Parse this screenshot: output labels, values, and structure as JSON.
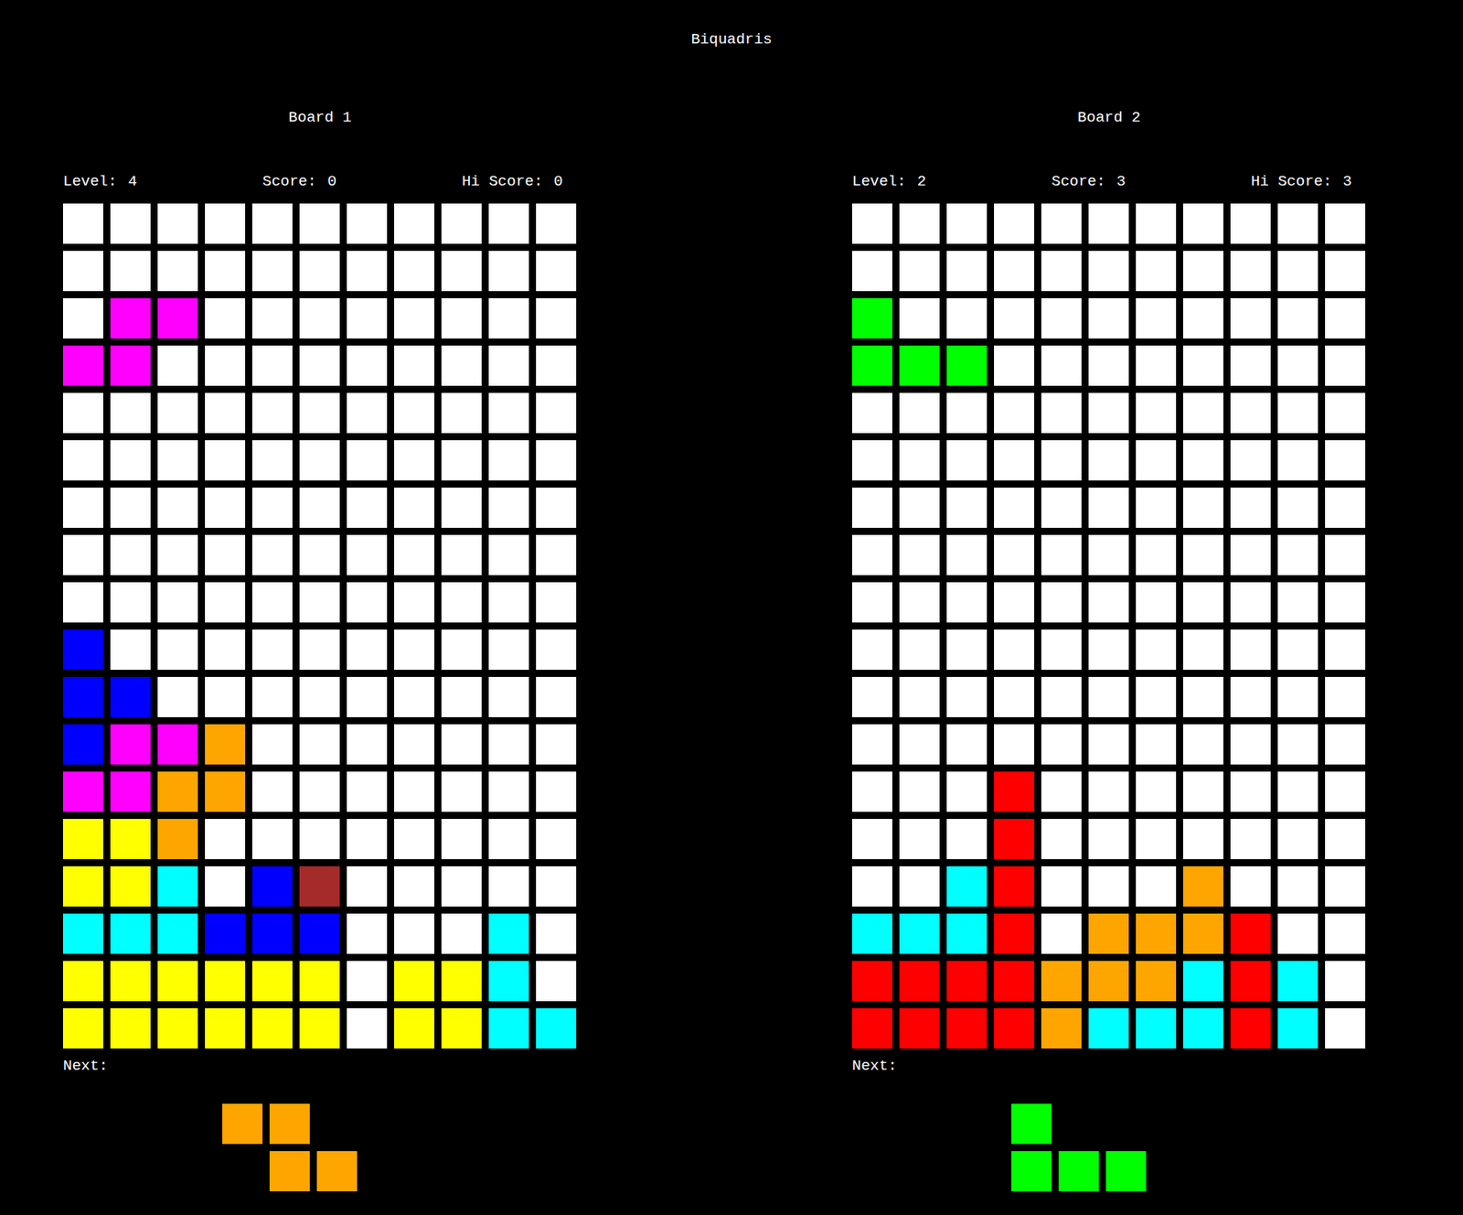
{
  "title": "Biquadris",
  "boards": [
    {
      "name": "Board 1",
      "stats": [
        {
          "label": "Level:",
          "value": "4"
        },
        {
          "label": "Score:",
          "value": "0"
        },
        {
          "label": "Hi Score:",
          "value": "0"
        }
      ],
      "next_label": "Next:",
      "grid": [
        [
          "#ffffff",
          "#ffffff",
          "#ffffff",
          "#ffffff",
          "#ffffff",
          "#ffffff",
          "#ffffff",
          "#ffffff",
          "#ffffff",
          "#ffffff",
          "#ffffff"
        ],
        [
          "#ffffff",
          "#ffffff",
          "#ffffff",
          "#ffffff",
          "#ffffff",
          "#ffffff",
          "#ffffff",
          "#ffffff",
          "#ffffff",
          "#ffffff",
          "#ffffff"
        ],
        [
          "#ffffff",
          "#ff00ff",
          "#ff00ff",
          "#ffffff",
          "#ffffff",
          "#ffffff",
          "#ffffff",
          "#ffffff",
          "#ffffff",
          "#ffffff",
          "#ffffff"
        ],
        [
          "#ff00ff",
          "#ff00ff",
          "#ffffff",
          "#ffffff",
          "#ffffff",
          "#ffffff",
          "#ffffff",
          "#ffffff",
          "#ffffff",
          "#ffffff",
          "#ffffff"
        ],
        [
          "#ffffff",
          "#ffffff",
          "#ffffff",
          "#ffffff",
          "#ffffff",
          "#ffffff",
          "#ffffff",
          "#ffffff",
          "#ffffff",
          "#ffffff",
          "#ffffff"
        ],
        [
          "#ffffff",
          "#ffffff",
          "#ffffff",
          "#ffffff",
          "#ffffff",
          "#ffffff",
          "#ffffff",
          "#ffffff",
          "#ffffff",
          "#ffffff",
          "#ffffff"
        ],
        [
          "#ffffff",
          "#ffffff",
          "#ffffff",
          "#ffffff",
          "#ffffff",
          "#ffffff",
          "#ffffff",
          "#ffffff",
          "#ffffff",
          "#ffffff",
          "#ffffff"
        ],
        [
          "#ffffff",
          "#ffffff",
          "#ffffff",
          "#ffffff",
          "#ffffff",
          "#ffffff",
          "#ffffff",
          "#ffffff",
          "#ffffff",
          "#ffffff",
          "#ffffff"
        ],
        [
          "#ffffff",
          "#ffffff",
          "#ffffff",
          "#ffffff",
          "#ffffff",
          "#ffffff",
          "#ffffff",
          "#ffffff",
          "#ffffff",
          "#ffffff",
          "#ffffff"
        ],
        [
          "#0000ff",
          "#ffffff",
          "#ffffff",
          "#ffffff",
          "#ffffff",
          "#ffffff",
          "#ffffff",
          "#ffffff",
          "#ffffff",
          "#ffffff",
          "#ffffff"
        ],
        [
          "#0000ff",
          "#0000ff",
          "#ffffff",
          "#ffffff",
          "#ffffff",
          "#ffffff",
          "#ffffff",
          "#ffffff",
          "#ffffff",
          "#ffffff",
          "#ffffff"
        ],
        [
          "#0000ff",
          "#ff00ff",
          "#ff00ff",
          "#ffa500",
          "#ffffff",
          "#ffffff",
          "#ffffff",
          "#ffffff",
          "#ffffff",
          "#ffffff",
          "#ffffff"
        ],
        [
          "#ff00ff",
          "#ff00ff",
          "#ffa500",
          "#ffa500",
          "#ffffff",
          "#ffffff",
          "#ffffff",
          "#ffffff",
          "#ffffff",
          "#ffffff",
          "#ffffff"
        ],
        [
          "#ffff00",
          "#ffff00",
          "#ffa500",
          "#ffffff",
          "#ffffff",
          "#ffffff",
          "#ffffff",
          "#ffffff",
          "#ffffff",
          "#ffffff",
          "#ffffff"
        ],
        [
          "#ffff00",
          "#ffff00",
          "#00ffff",
          "#ffffff",
          "#0000ff",
          "#a52a2a",
          "#ffffff",
          "#ffffff",
          "#ffffff",
          "#ffffff",
          "#ffffff"
        ],
        [
          "#00ffff",
          "#00ffff",
          "#00ffff",
          "#0000ff",
          "#0000ff",
          "#0000ff",
          "#ffffff",
          "#ffffff",
          "#ffffff",
          "#00ffff",
          "#ffffff"
        ],
        [
          "#ffff00",
          "#ffff00",
          "#ffff00",
          "#ffff00",
          "#ffff00",
          "#ffff00",
          "#ffffff",
          "#ffff00",
          "#ffff00",
          "#00ffff",
          "#ffffff"
        ],
        [
          "#ffff00",
          "#ffff00",
          "#ffff00",
          "#ffff00",
          "#ffff00",
          "#ffff00",
          "#ffffff",
          "#ffff00",
          "#ffff00",
          "#00ffff",
          "#00ffff"
        ]
      ],
      "next": [
        [
          "#ffa500",
          "#ffa500",
          null
        ],
        [
          null,
          "#ffa500",
          "#ffa500"
        ]
      ]
    },
    {
      "name": "Board 2",
      "stats": [
        {
          "label": "Level:",
          "value": "2"
        },
        {
          "label": "Score:",
          "value": "3"
        },
        {
          "label": "Hi Score:",
          "value": "3"
        }
      ],
      "next_label": "Next:",
      "grid": [
        [
          "#ffffff",
          "#ffffff",
          "#ffffff",
          "#ffffff",
          "#ffffff",
          "#ffffff",
          "#ffffff",
          "#ffffff",
          "#ffffff",
          "#ffffff",
          "#ffffff"
        ],
        [
          "#ffffff",
          "#ffffff",
          "#ffffff",
          "#ffffff",
          "#ffffff",
          "#ffffff",
          "#ffffff",
          "#ffffff",
          "#ffffff",
          "#ffffff",
          "#ffffff"
        ],
        [
          "#00ff00",
          "#ffffff",
          "#ffffff",
          "#ffffff",
          "#ffffff",
          "#ffffff",
          "#ffffff",
          "#ffffff",
          "#ffffff",
          "#ffffff",
          "#ffffff"
        ],
        [
          "#00ff00",
          "#00ff00",
          "#00ff00",
          "#ffffff",
          "#ffffff",
          "#ffffff",
          "#ffffff",
          "#ffffff",
          "#ffffff",
          "#ffffff",
          "#ffffff"
        ],
        [
          "#ffffff",
          "#ffffff",
          "#ffffff",
          "#ffffff",
          "#ffffff",
          "#ffffff",
          "#ffffff",
          "#ffffff",
          "#ffffff",
          "#ffffff",
          "#ffffff"
        ],
        [
          "#ffffff",
          "#ffffff",
          "#ffffff",
          "#ffffff",
          "#ffffff",
          "#ffffff",
          "#ffffff",
          "#ffffff",
          "#ffffff",
          "#ffffff",
          "#ffffff"
        ],
        [
          "#ffffff",
          "#ffffff",
          "#ffffff",
          "#ffffff",
          "#ffffff",
          "#ffffff",
          "#ffffff",
          "#ffffff",
          "#ffffff",
          "#ffffff",
          "#ffffff"
        ],
        [
          "#ffffff",
          "#ffffff",
          "#ffffff",
          "#ffffff",
          "#ffffff",
          "#ffffff",
          "#ffffff",
          "#ffffff",
          "#ffffff",
          "#ffffff",
          "#ffffff"
        ],
        [
          "#ffffff",
          "#ffffff",
          "#ffffff",
          "#ffffff",
          "#ffffff",
          "#ffffff",
          "#ffffff",
          "#ffffff",
          "#ffffff",
          "#ffffff",
          "#ffffff"
        ],
        [
          "#ffffff",
          "#ffffff",
          "#ffffff",
          "#ffffff",
          "#ffffff",
          "#ffffff",
          "#ffffff",
          "#ffffff",
          "#ffffff",
          "#ffffff",
          "#ffffff"
        ],
        [
          "#ffffff",
          "#ffffff",
          "#ffffff",
          "#ffffff",
          "#ffffff",
          "#ffffff",
          "#ffffff",
          "#ffffff",
          "#ffffff",
          "#ffffff",
          "#ffffff"
        ],
        [
          "#ffffff",
          "#ffffff",
          "#ffffff",
          "#ffffff",
          "#ffffff",
          "#ffffff",
          "#ffffff",
          "#ffffff",
          "#ffffff",
          "#ffffff",
          "#ffffff"
        ],
        [
          "#ffffff",
          "#ffffff",
          "#ffffff",
          "#ff0000",
          "#ffffff",
          "#ffffff",
          "#ffffff",
          "#ffffff",
          "#ffffff",
          "#ffffff",
          "#ffffff"
        ],
        [
          "#ffffff",
          "#ffffff",
          "#ffffff",
          "#ff0000",
          "#ffffff",
          "#ffffff",
          "#ffffff",
          "#ffffff",
          "#ffffff",
          "#ffffff",
          "#ffffff"
        ],
        [
          "#ffffff",
          "#ffffff",
          "#00ffff",
          "#ff0000",
          "#ffffff",
          "#ffffff",
          "#ffffff",
          "#ffa500",
          "#ffffff",
          "#ffffff",
          "#ffffff"
        ],
        [
          "#00ffff",
          "#00ffff",
          "#00ffff",
          "#ff0000",
          "#ffffff",
          "#ffa500",
          "#ffa500",
          "#ffa500",
          "#ff0000",
          "#ffffff",
          "#ffffff"
        ],
        [
          "#ff0000",
          "#ff0000",
          "#ff0000",
          "#ff0000",
          "#ffa500",
          "#ffa500",
          "#ffa500",
          "#00ffff",
          "#ff0000",
          "#00ffff",
          "#ffffff"
        ],
        [
          "#ff0000",
          "#ff0000",
          "#ff0000",
          "#ff0000",
          "#ffa500",
          "#00ffff",
          "#00ffff",
          "#00ffff",
          "#ff0000",
          "#00ffff",
          "#ffffff"
        ]
      ],
      "next": [
        [
          "#00ff00",
          null,
          null
        ],
        [
          "#00ff00",
          "#00ff00",
          "#00ff00"
        ]
      ]
    }
  ]
}
